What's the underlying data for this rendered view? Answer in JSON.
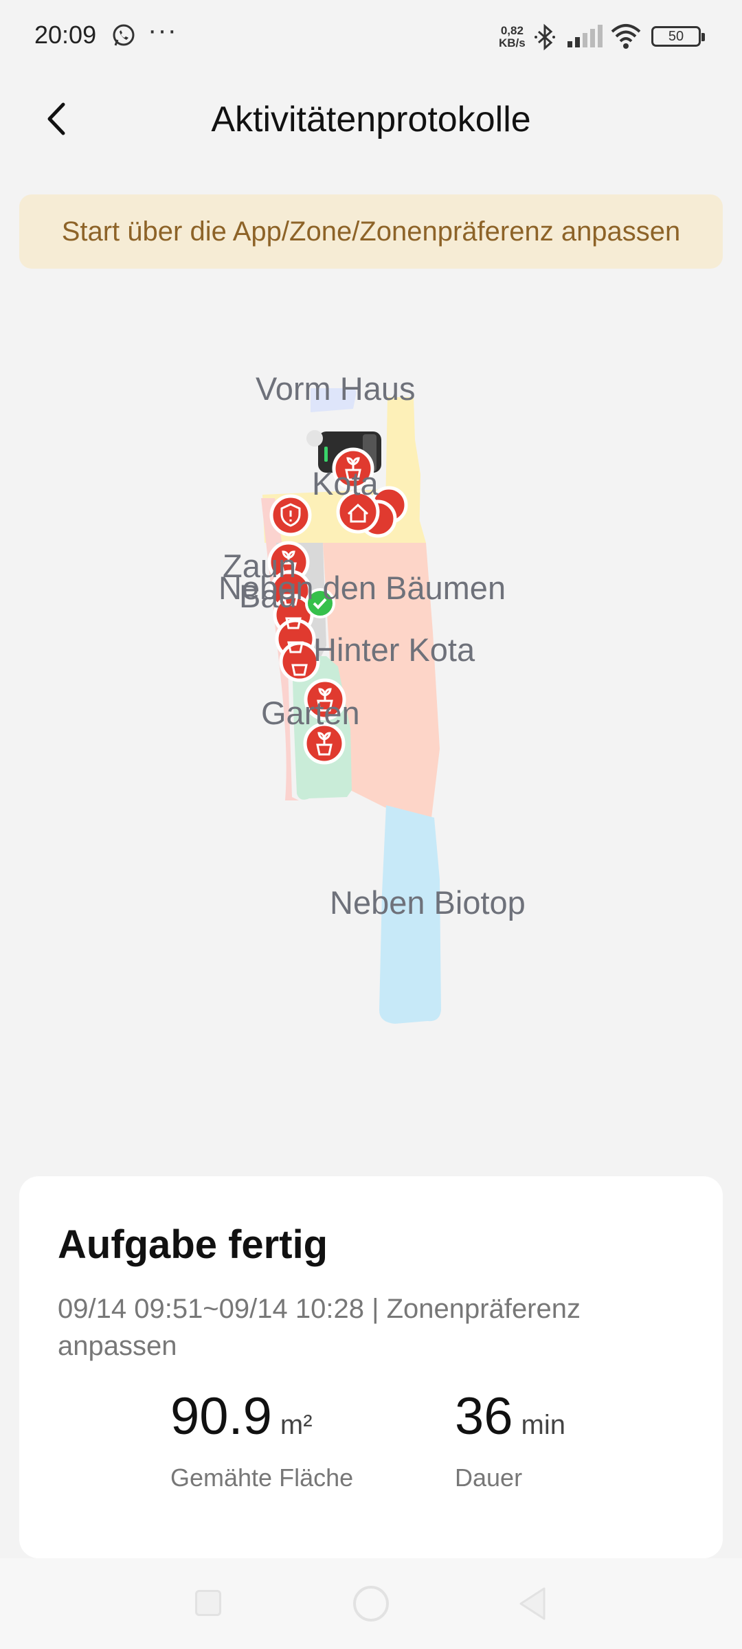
{
  "status_bar": {
    "time": "20:09",
    "network_speed_value": "0,82",
    "network_speed_unit": "KB/s",
    "battery": "50",
    "icons": [
      "whatsapp-icon",
      "more-dots-icon",
      "bluetooth-icon",
      "signal-icon",
      "wifi-icon",
      "battery-icon"
    ]
  },
  "header": {
    "title": "Aktivitätenprotokolle",
    "back_icon": "chevron-left-icon"
  },
  "banner": {
    "text": "Start über die App/Zone/Zonenpräferenz anpassen"
  },
  "map": {
    "zones": [
      {
        "label": "Vorm Haus",
        "color": "#fdf0b8"
      },
      {
        "label": "Kota",
        "color": "#fdf0b8"
      },
      {
        "label": "Zaun",
        "color": "#fbd3cf"
      },
      {
        "label": "Bad",
        "color": "#d9d9d9"
      },
      {
        "label": "Neben den Bäumen",
        "color": "#fdd5c8"
      },
      {
        "label": "Hinter Kota",
        "color": "#fdd5c8"
      },
      {
        "label": "Garten",
        "color": "#c9ecd8"
      },
      {
        "label": "Neben Biotop",
        "color": "#c7e9f8"
      }
    ],
    "markers": [
      "plant-pin-icon",
      "home-pin-icon",
      "alert-pin-icon",
      "check-pin-icon",
      "charging-station-icon"
    ]
  },
  "task": {
    "status": "Aufgabe fertig",
    "meta": "09/14 09:51~09/14 10:28 | Zonenpräferenz anpassen",
    "area_value": "90.9",
    "area_unit": "m²",
    "area_label": "Gemähte Fläche",
    "duration_value": "36",
    "duration_unit": "min",
    "duration_label": "Dauer"
  },
  "colors": {
    "accent_red": "#e03a2f",
    "banner_bg": "#f6ecd5",
    "banner_text": "#8d6328",
    "check_green": "#36c04b"
  }
}
